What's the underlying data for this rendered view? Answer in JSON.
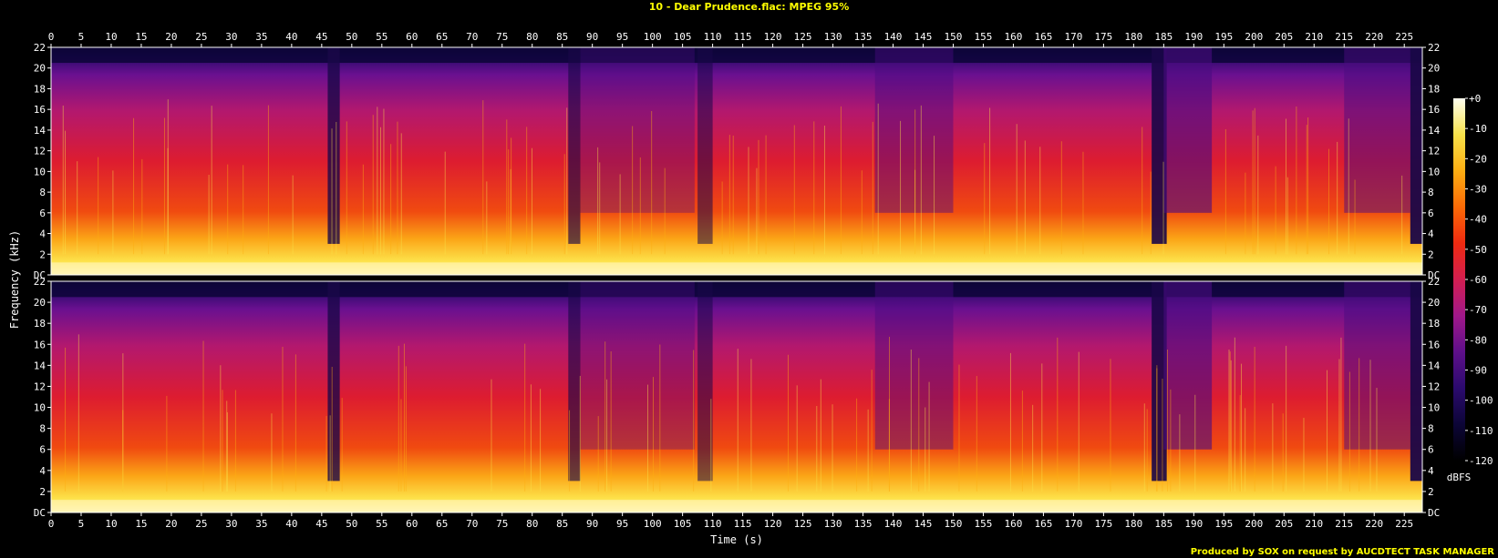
{
  "window": {
    "title": "10 - Dear Prudence.flac: MPEG 95%",
    "credit": "Produced by SOX on request by AUCDTECT TASK MANAGER"
  },
  "colors": {
    "background": "#000000",
    "title": "#ffff00",
    "axis": "#ffffff",
    "palette": [
      "#000000",
      "#0c0537",
      "#2b0a6e",
      "#5e0f8a",
      "#a1188a",
      "#d31e50",
      "#ef2a10",
      "#fb6a06",
      "#fdae12",
      "#f8e24a",
      "#fffff0"
    ]
  },
  "chart_data": {
    "type": "heatmap",
    "subtype": "spectrogram",
    "xlabel": "Time (s)",
    "ylabel": "Frequency (kHz)",
    "colorbar_label": "dBFS",
    "xlim": [
      0,
      228
    ],
    "ylim": [
      0,
      22
    ],
    "x_ticks": [
      0,
      5,
      10,
      15,
      20,
      25,
      30,
      35,
      40,
      45,
      50,
      55,
      60,
      65,
      70,
      75,
      80,
      85,
      90,
      95,
      100,
      105,
      110,
      115,
      120,
      125,
      130,
      135,
      140,
      145,
      150,
      155,
      160,
      165,
      170,
      175,
      180,
      185,
      190,
      195,
      200,
      205,
      210,
      215,
      220,
      225
    ],
    "y_ticks": [
      "DC",
      "2",
      "4",
      "6",
      "8",
      "10",
      "12",
      "14",
      "16",
      "18",
      "20",
      "22"
    ],
    "colorbar_ticks": [
      "+0",
      "-10",
      "-20",
      "-30",
      "-40",
      "-50",
      "-60",
      "-70",
      "-80",
      "-90",
      "-100",
      "-110",
      "-120"
    ],
    "colorbar_range": [
      -120,
      0
    ],
    "channels": 2,
    "grid": false
  }
}
